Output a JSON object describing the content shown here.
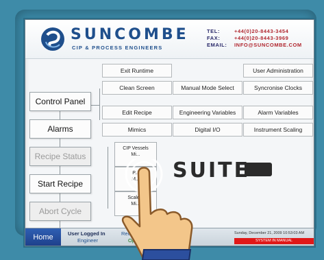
{
  "header": {
    "brand": "SUNCOMBE",
    "tagline": "CIP & PROCESS ENGINEERS",
    "contact_labels": [
      "TEL:",
      "FAX:",
      "EMAIL:"
    ],
    "contact_values": [
      "+44(0)20-8443-3454",
      "+44(0)20-8443-3969",
      "INFO@SUNCOMBE.COM"
    ]
  },
  "menu": {
    "row1": [
      "Exit Runtime",
      "User Administration"
    ],
    "row2": [
      "Clean Screen",
      "Manual Mode Select",
      "Syncronise Clocks"
    ],
    "row3": [
      "Edit Recipe",
      "Engineering Variables",
      "Alarm Variables"
    ],
    "row4": [
      "Mimics",
      "Digital I/O",
      "Instrument Scaling"
    ]
  },
  "sidebar": [
    {
      "label": "Control Panel",
      "enabled": true
    },
    {
      "label": "Alarms",
      "enabled": true
    },
    {
      "label": "Recipe Status",
      "enabled": false
    },
    {
      "label": "Start Recipe",
      "enabled": true
    },
    {
      "label": "Abort Cycle",
      "enabled": false
    }
  ],
  "background_text": "SUITE",
  "submenu": [
    {
      "line1": "CIP Vessels",
      "line2": "Mi..."
    },
    {
      "line1": "P...",
      "line2": "M..."
    },
    {
      "line1": "Scale...",
      "line2": "Mi..."
    }
  ],
  "status": {
    "home": "Home",
    "user_label": "User Logged In",
    "user_value": "Engineer",
    "recipe_label": "Reci... ...sample Recipe1",
    "recipe_value": "Op...",
    "datetime": "Sunday, December 21, 2009   10:53:03 AM",
    "mode": "SYSTEM IN MANUAL"
  },
  "colors": {
    "brand": "#1f4f8c",
    "mode_alert": "#e01818",
    "home": "#2f5fb3"
  }
}
